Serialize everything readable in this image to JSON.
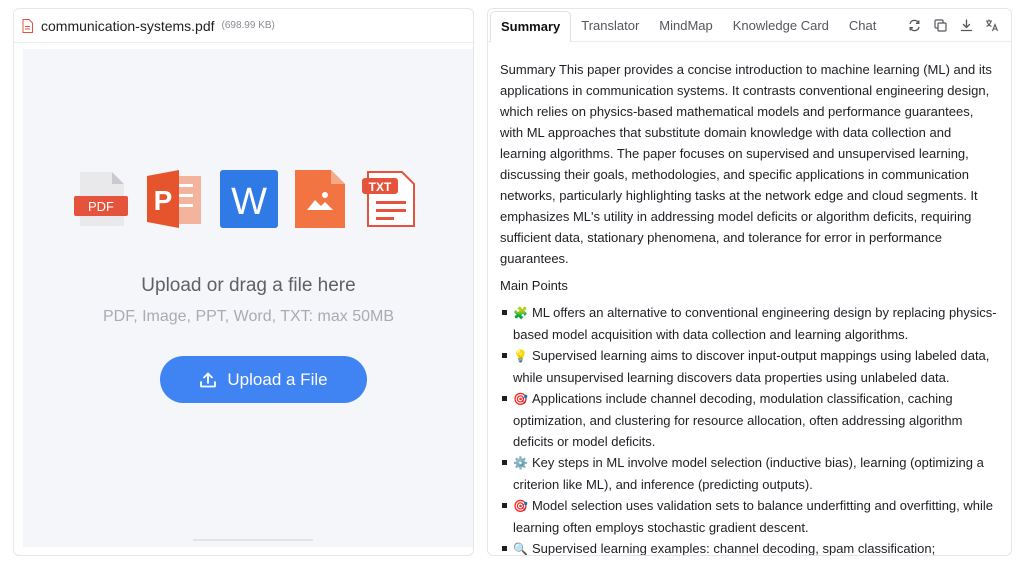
{
  "file": {
    "name": "communication-systems.pdf",
    "size": "(698.99 KB)"
  },
  "upload": {
    "title": "Upload or drag a file here",
    "subtitle": "PDF, Image, PPT, Word, TXT: max 50MB",
    "button_label": "Upload a File",
    "icons": [
      "pdf-file-icon",
      "ppt-file-icon",
      "word-file-icon",
      "image-file-icon",
      "txt-file-icon"
    ],
    "icon_labels": {
      "pdf": "PDF",
      "ppt": "P",
      "word": "W",
      "txt": "TXT"
    }
  },
  "tabs": [
    {
      "label": "Summary",
      "active": true
    },
    {
      "label": "Translator",
      "active": false
    },
    {
      "label": "MindMap",
      "active": false
    },
    {
      "label": "Knowledge Card",
      "active": false
    },
    {
      "label": "Chat",
      "active": false
    }
  ],
  "toolbar_icons": [
    "refresh-icon",
    "copy-icon",
    "download-icon",
    "translate-icon"
  ],
  "summary": {
    "text": "Summary This paper provides a concise introduction to machine learning (ML) and its applications in communication systems. It contrasts conventional engineering design, which relies on physics-based mathematical models and performance guarantees, with ML approaches that substitute domain knowledge with data collection and learning algorithms. The paper focuses on supervised and unsupervised learning, discussing their goals, methodologies, and specific applications in communication networks, particularly highlighting tasks at the network edge and cloud segments. It emphasizes ML's utility in addressing model deficits or algorithm deficits, requiring sufficient data, stationary phenomena, and tolerance for error in performance guarantees.",
    "main_points_title": "Main Points",
    "points": [
      {
        "emoji": "🧩",
        "text": "ML offers an alternative to conventional engineering design by replacing physics-based model acquisition with data collection and learning algorithms."
      },
      {
        "emoji": "💡",
        "text": "Supervised learning aims to discover input-output mappings using labeled data, while unsupervised learning discovers data properties using unlabeled data."
      },
      {
        "emoji": "🎯",
        "text": "Applications include channel decoding, modulation classification, caching optimization, and clustering for resource allocation, often addressing algorithm deficits or model deficits."
      },
      {
        "emoji": "⚙️",
        "text": "Key steps in ML involve model selection (inductive bias), learning (optimizing a criterion like ML), and inference (predicting outputs)."
      },
      {
        "emoji": "🎯",
        "text": "Model selection uses validation sets to balance underfitting and overfitting, while learning often employs stochastic gradient descent."
      },
      {
        "emoji": "🔍",
        "text": "Supervised learning examples: channel decoding, spam classification;"
      }
    ]
  },
  "colors": {
    "accent": "#3f84f2",
    "pdf_red": "#e5533d",
    "ppt_orange": "#e5542c",
    "word_blue": "#2f7ae5",
    "image_orange": "#f27443"
  }
}
